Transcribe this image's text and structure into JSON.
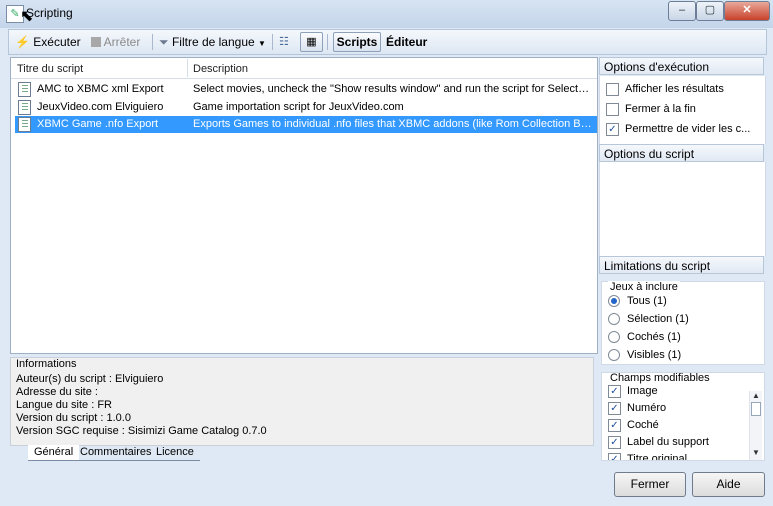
{
  "window": {
    "title": "Scripting",
    "minimize": "–",
    "maximize": "▢",
    "close": "✕"
  },
  "toolbar": {
    "run": "Exécuter",
    "stop": "Arrêter",
    "language_filter": "Filtre de langue",
    "tab_scripts": "Scripts",
    "tab_editor": "Éditeur"
  },
  "list": {
    "headers": {
      "title": "Titre du script",
      "description": "Description"
    },
    "rows": [
      {
        "title": "AMC to XBMC xml Export",
        "description": "Select movies, uncheck the \"Show results window\" and run the script for Selecte..."
      },
      {
        "title": "JeuxVideo.com Elviguiero",
        "description": "Game importation script for JeuxVideo.com"
      },
      {
        "title": "XBMC Game .nfo Export",
        "description": "Exports Games to individual .nfo files that XBMC addons (like Rom Collection Bro..."
      }
    ],
    "selected_index": 2
  },
  "info": {
    "heading": "Informations",
    "lines": [
      "Auteur(s) du script : Elviguiero",
      "Adresse du site :",
      "Langue du site : FR",
      "Version du script : 1.0.0",
      "Version SGC requise : Sisimizi Game Catalog 0.7.0"
    ],
    "tabs": [
      "Général",
      "Commentaires",
      "Licence"
    ]
  },
  "exec_options": {
    "heading": "Options d'exécution",
    "items": [
      {
        "label": "Afficher les résultats",
        "checked": false
      },
      {
        "label": "Fermer à la fin",
        "checked": false
      },
      {
        "label": "Permettre de vider les c...",
        "checked": true
      }
    ]
  },
  "script_options": {
    "heading": "Options du script"
  },
  "limits": {
    "heading": "Limitations du script",
    "games_group": "Jeux à inclure",
    "radios": [
      {
        "label": "Tous (1)",
        "selected": true
      },
      {
        "label": "Sélection (1)",
        "selected": false
      },
      {
        "label": "Cochés (1)",
        "selected": false
      },
      {
        "label": "Visibles (1)",
        "selected": false
      }
    ],
    "fields_group": "Champs modifiables",
    "fields": [
      {
        "label": "Image",
        "checked": true
      },
      {
        "label": "Numéro",
        "checked": true
      },
      {
        "label": "Coché",
        "checked": true
      },
      {
        "label": "Label du support",
        "checked": true
      },
      {
        "label": "Titre original",
        "checked": true
      }
    ]
  },
  "buttons": {
    "close": "Fermer",
    "help": "Aide"
  },
  "colors": {
    "selection": "#3399ff",
    "window_bg": "#dfe9f5"
  }
}
